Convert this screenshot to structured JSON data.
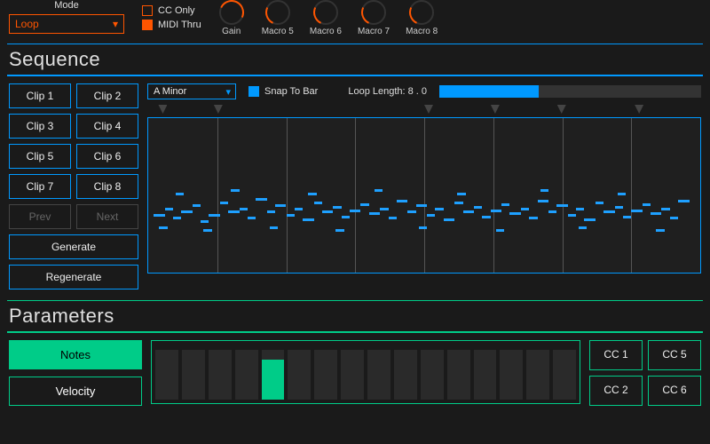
{
  "top": {
    "mode_label": "Mode",
    "mode_value": "Loop",
    "cc_only_label": "CC Only",
    "midi_thru_label": "MIDI Thru",
    "gain_label": "Gain",
    "macros": [
      "Macro 5",
      "Macro 6",
      "Macro 7",
      "Macro 8"
    ]
  },
  "sequence": {
    "title": "Sequence",
    "clips": [
      "Clip 1",
      "Clip 2",
      "Clip 3",
      "Clip 4",
      "Clip 5",
      "Clip 6",
      "Clip 7",
      "Clip 8"
    ],
    "prev_label": "Prev",
    "next_label": "Next",
    "generate_label": "Generate",
    "regenerate_label": "Regenerate",
    "scale_value": "A Minor",
    "snap_label": "Snap To Bar",
    "loop_label": "Loop Length: 8 . 0",
    "loop_fill_pct": 38,
    "marker_positions_pct": [
      2,
      12,
      50,
      62,
      74,
      88
    ],
    "grid_lines_pct": [
      12.5,
      25,
      37.5,
      50,
      62.5,
      75,
      87.5
    ],
    "notes": [
      {
        "l": 1,
        "t": 62,
        "w": 2
      },
      {
        "l": 3,
        "t": 58,
        "w": 1.5
      },
      {
        "l": 4.5,
        "t": 64,
        "w": 1.5
      },
      {
        "l": 6,
        "t": 60,
        "w": 2
      },
      {
        "l": 8,
        "t": 56,
        "w": 1.5
      },
      {
        "l": 9.5,
        "t": 66,
        "w": 1.5
      },
      {
        "l": 11,
        "t": 62,
        "w": 2
      },
      {
        "l": 13,
        "t": 54,
        "w": 1.5
      },
      {
        "l": 14.5,
        "t": 60,
        "w": 2
      },
      {
        "l": 16.5,
        "t": 58,
        "w": 1.5
      },
      {
        "l": 18,
        "t": 64,
        "w": 1.5
      },
      {
        "l": 19.5,
        "t": 52,
        "w": 2
      },
      {
        "l": 21.5,
        "t": 60,
        "w": 1.5
      },
      {
        "l": 23,
        "t": 56,
        "w": 2
      },
      {
        "l": 25,
        "t": 62,
        "w": 1.5
      },
      {
        "l": 26.5,
        "t": 58,
        "w": 1.5
      },
      {
        "l": 28,
        "t": 65,
        "w": 2
      },
      {
        "l": 30,
        "t": 54,
        "w": 1.5
      },
      {
        "l": 31.5,
        "t": 60,
        "w": 2
      },
      {
        "l": 33.5,
        "t": 57,
        "w": 1.5
      },
      {
        "l": 35,
        "t": 63,
        "w": 1.5
      },
      {
        "l": 36.5,
        "t": 59,
        "w": 2
      },
      {
        "l": 38.5,
        "t": 55,
        "w": 1.5
      },
      {
        "l": 40,
        "t": 61,
        "w": 2
      },
      {
        "l": 42,
        "t": 58,
        "w": 1.5
      },
      {
        "l": 43.5,
        "t": 64,
        "w": 1.5
      },
      {
        "l": 45,
        "t": 53,
        "w": 2
      },
      {
        "l": 47,
        "t": 60,
        "w": 1.5
      },
      {
        "l": 48.5,
        "t": 56,
        "w": 2
      },
      {
        "l": 50.5,
        "t": 62,
        "w": 1.5
      },
      {
        "l": 52,
        "t": 58,
        "w": 1.5
      },
      {
        "l": 53.5,
        "t": 65,
        "w": 2
      },
      {
        "l": 55.5,
        "t": 54,
        "w": 1.5
      },
      {
        "l": 57,
        "t": 60,
        "w": 2
      },
      {
        "l": 59,
        "t": 57,
        "w": 1.5
      },
      {
        "l": 60.5,
        "t": 63,
        "w": 1.5
      },
      {
        "l": 62,
        "t": 59,
        "w": 2
      },
      {
        "l": 64,
        "t": 55,
        "w": 1.5
      },
      {
        "l": 65.5,
        "t": 61,
        "w": 2
      },
      {
        "l": 67.5,
        "t": 58,
        "w": 1.5
      },
      {
        "l": 69,
        "t": 64,
        "w": 1.5
      },
      {
        "l": 70.5,
        "t": 53,
        "w": 2
      },
      {
        "l": 72.5,
        "t": 60,
        "w": 1.5
      },
      {
        "l": 74,
        "t": 56,
        "w": 2
      },
      {
        "l": 76,
        "t": 62,
        "w": 1.5
      },
      {
        "l": 77.5,
        "t": 58,
        "w": 1.5
      },
      {
        "l": 79,
        "t": 65,
        "w": 2
      },
      {
        "l": 81,
        "t": 54,
        "w": 1.5
      },
      {
        "l": 82.5,
        "t": 60,
        "w": 2
      },
      {
        "l": 84.5,
        "t": 57,
        "w": 1.5
      },
      {
        "l": 86,
        "t": 63,
        "w": 1.5
      },
      {
        "l": 87.5,
        "t": 59,
        "w": 2
      },
      {
        "l": 89.5,
        "t": 55,
        "w": 1.5
      },
      {
        "l": 91,
        "t": 61,
        "w": 2
      },
      {
        "l": 93,
        "t": 58,
        "w": 1.5
      },
      {
        "l": 94.5,
        "t": 64,
        "w": 1.5
      },
      {
        "l": 96,
        "t": 53,
        "w": 2
      },
      {
        "l": 2,
        "t": 70,
        "w": 1.5
      },
      {
        "l": 5,
        "t": 48,
        "w": 1.5
      },
      {
        "l": 10,
        "t": 72,
        "w": 1.5
      },
      {
        "l": 15,
        "t": 46,
        "w": 1.5
      },
      {
        "l": 22,
        "t": 70,
        "w": 1.5
      },
      {
        "l": 29,
        "t": 48,
        "w": 1.5
      },
      {
        "l": 34,
        "t": 72,
        "w": 1.5
      },
      {
        "l": 41,
        "t": 46,
        "w": 1.5
      },
      {
        "l": 49,
        "t": 70,
        "w": 1.5
      },
      {
        "l": 56,
        "t": 48,
        "w": 1.5
      },
      {
        "l": 63,
        "t": 72,
        "w": 1.5
      },
      {
        "l": 71,
        "t": 46,
        "w": 1.5
      },
      {
        "l": 78,
        "t": 70,
        "w": 1.5
      },
      {
        "l": 85,
        "t": 48,
        "w": 1.5
      },
      {
        "l": 92,
        "t": 72,
        "w": 1.5
      }
    ]
  },
  "parameters": {
    "title": "Parameters",
    "notes_label": "Notes",
    "velocity_label": "Velocity",
    "bar_heights_pct": [
      0,
      0,
      0,
      0,
      80,
      0,
      0,
      0,
      0,
      0,
      0,
      0,
      0,
      0,
      0,
      0
    ],
    "cc_buttons": [
      "CC 1",
      "CC 5",
      "CC 2",
      "CC 6"
    ]
  },
  "colors": {
    "accent_orange": "#ff5500",
    "accent_blue": "#0099ff",
    "accent_green": "#00cc88"
  }
}
